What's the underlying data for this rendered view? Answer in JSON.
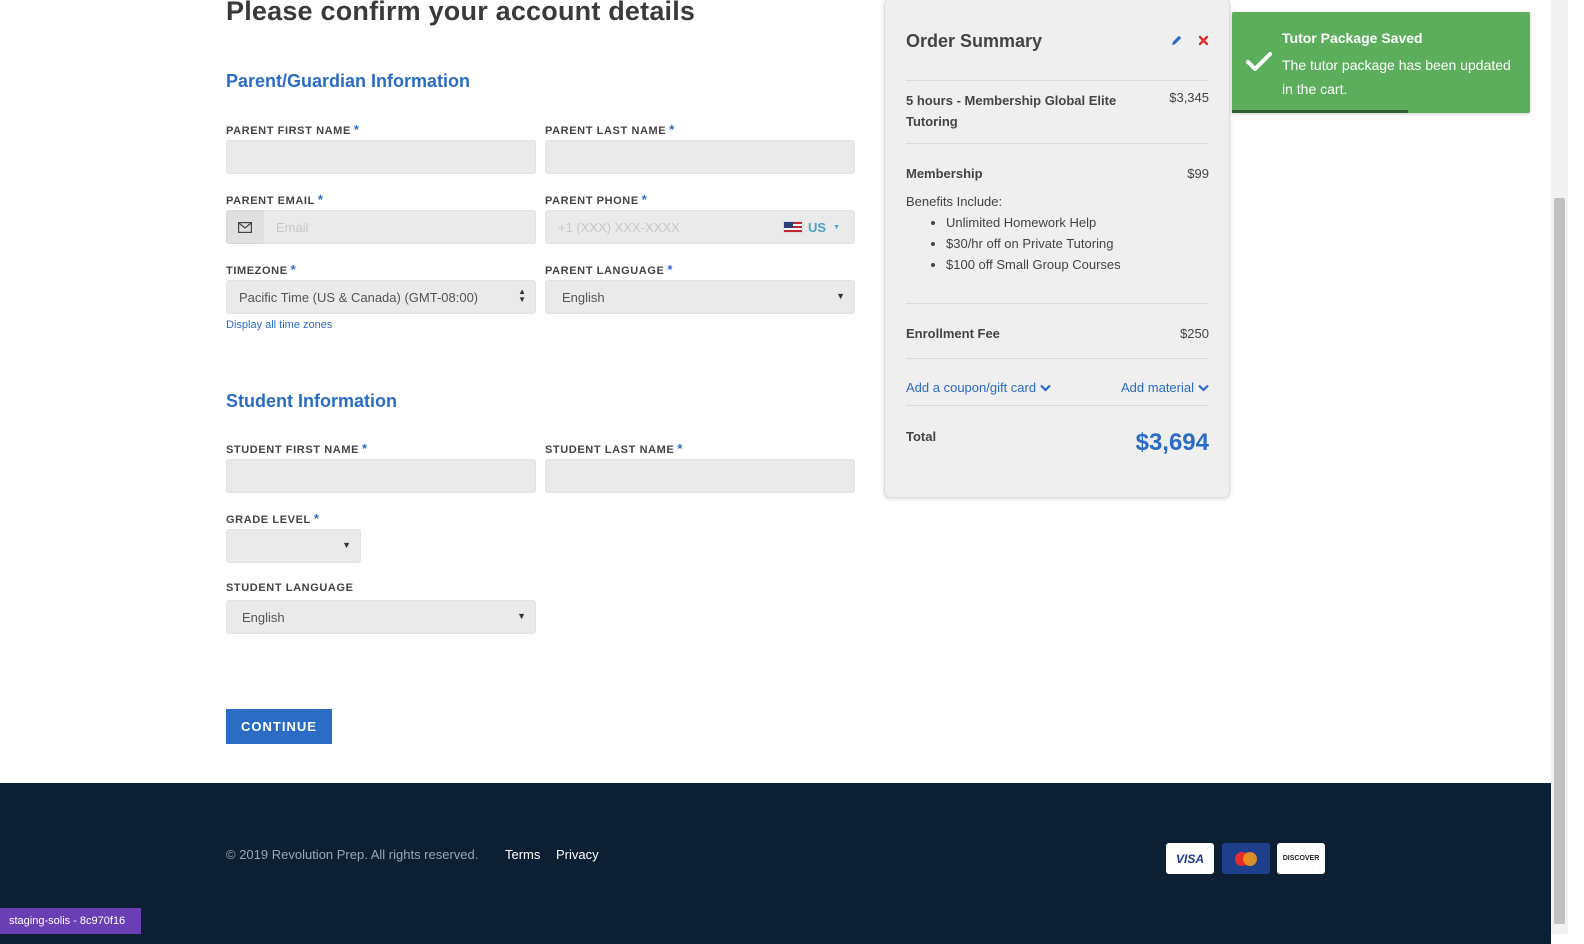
{
  "page": {
    "title": "Please confirm your account details"
  },
  "parent_section": {
    "title": "Parent/Guardian Information",
    "first_name": {
      "label": "PARENT FIRST NAME",
      "value": "",
      "placeholder": ""
    },
    "last_name": {
      "label": "PARENT LAST NAME",
      "value": "",
      "placeholder": ""
    },
    "email": {
      "label": "PARENT EMAIL",
      "value": "",
      "placeholder": "Email",
      "icon": "envelope-icon"
    },
    "phone": {
      "label": "PARENT PHONE",
      "value": "",
      "placeholder": "+1 (XXX) XXX-XXXX",
      "country": "US",
      "flag_icon": "us-flag-icon"
    },
    "timezone": {
      "label": "TIMEZONE",
      "value": "Pacific Time (US & Canada) (GMT-08:00)",
      "link": "Display all time zones"
    },
    "language": {
      "label": "PARENT LANGUAGE",
      "value": "English"
    },
    "required_marker": "*"
  },
  "student_section": {
    "title": "Student Information",
    "first_name": {
      "label": "STUDENT FIRST NAME",
      "value": "",
      "placeholder": ""
    },
    "last_name": {
      "label": "STUDENT LAST NAME",
      "value": "",
      "placeholder": ""
    },
    "grade": {
      "label": "GRADE LEVEL",
      "value": ""
    },
    "language": {
      "label": "STUDENT LANGUAGE",
      "value": "English"
    }
  },
  "continue_label": "CONTINUE",
  "order_summary": {
    "title": "Order Summary",
    "package": {
      "name": "5 hours - Membership Global Elite Tutoring",
      "price": "$3,345"
    },
    "membership": {
      "name": "Membership",
      "price": "$99",
      "benefits_heading": "Benefits Include:",
      "benefits": [
        "Unlimited Homework Help",
        "$30/hr off on Private Tutoring",
        "$100 off Small Group Courses"
      ]
    },
    "enrollment": {
      "name": "Enrollment Fee",
      "price": "$250"
    },
    "coupon_link": "Add a coupon/gift card",
    "material_link": "Add material",
    "total_label": "Total",
    "total_value": "$3,694"
  },
  "toast": {
    "title": "Tutor Package Saved",
    "message": "The tutor package has been updated in the cart.",
    "progress": 0.59,
    "color": "#5cad5c"
  },
  "footer": {
    "copyright": "© 2019 Revolution Prep. All rights reserved.",
    "links": [
      "Terms",
      "Privacy"
    ],
    "payment_cards": [
      "VISA",
      "MasterCard",
      "DISCOVER"
    ]
  },
  "staging_badge": "staging-solis - 8c970f16",
  "colors": {
    "accent": "#2b6cc4",
    "footer_bg": "#0d2033",
    "toast_bg": "#5cad5c",
    "staging_bg": "#6a3fb5"
  }
}
